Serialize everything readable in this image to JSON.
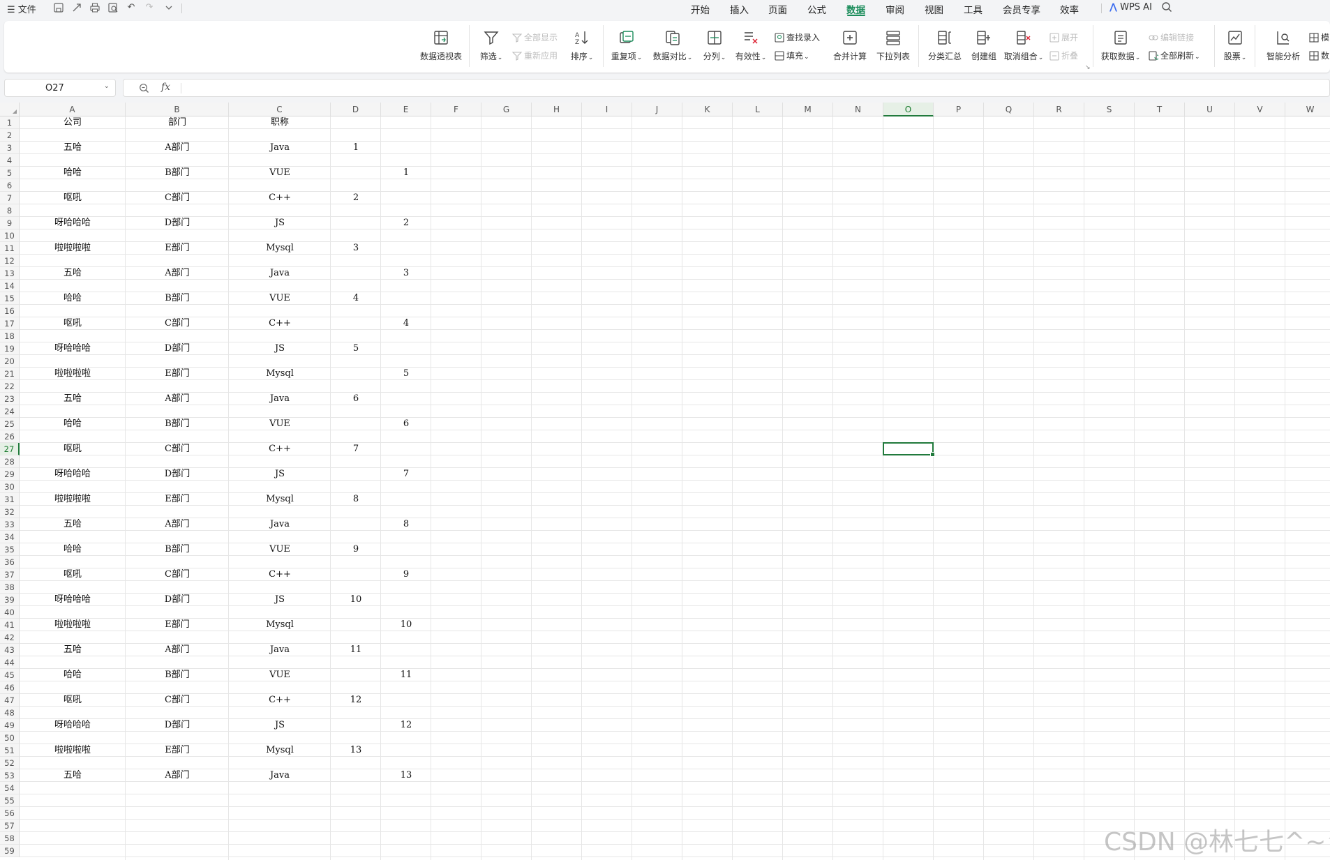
{
  "menu": {
    "file_label": "文件",
    "tabs": [
      "开始",
      "插入",
      "页面",
      "公式",
      "数据",
      "审阅",
      "视图",
      "工具",
      "会员专享",
      "效率"
    ],
    "active_tab": "数据",
    "ai_label": "WPS AI"
  },
  "ribbon": {
    "pivot": "数据透视表",
    "filter": "筛选",
    "show_all": "全部显示",
    "reapply": "重新应用",
    "sort": "排序",
    "duplicates": "重复项",
    "compare": "数据对比",
    "split": "分列",
    "validity": "有效性",
    "lookup_entry": "查找录入",
    "fill": "填充",
    "consolidate": "合并计算",
    "dropdown_list": "下拉列表",
    "subtotal": "分类汇总",
    "create_group": "创建组",
    "ungroup": "取消组合",
    "expand": "展开",
    "collapse": "折叠",
    "get_data": "获取数据",
    "edit_links": "编辑链接",
    "refresh_all": "全部刷新",
    "stocks": "股票",
    "smart_analysis": "智能分析",
    "more1": "模",
    "more2": "数"
  },
  "formula_bar": {
    "name_box": "O27",
    "fx": "fx",
    "formula": ""
  },
  "sheet": {
    "columns": [
      "A",
      "B",
      "C",
      "D",
      "E",
      "F",
      "G",
      "H",
      "I",
      "J",
      "K",
      "L",
      "M",
      "N",
      "O",
      "P",
      "Q",
      "R",
      "S",
      "T",
      "U",
      "V",
      "W"
    ],
    "selected_column": "O",
    "selected_row": 27,
    "row_count": 59,
    "headers": [
      "公司",
      "部门",
      "职称"
    ],
    "rows": [
      {
        "r": 3,
        "A": "五哈",
        "B": "A部门",
        "C": "Java",
        "D": "1",
        "E": ""
      },
      {
        "r": 5,
        "A": "哈哈",
        "B": "B部门",
        "C": "VUE",
        "D": "",
        "E": "1"
      },
      {
        "r": 7,
        "A": "呕吼",
        "B": "C部门",
        "C": "C++",
        "D": "2",
        "E": ""
      },
      {
        "r": 9,
        "A": "呀哈哈哈",
        "B": "D部门",
        "C": "JS",
        "D": "",
        "E": "2"
      },
      {
        "r": 11,
        "A": "啦啦啦啦",
        "B": "E部门",
        "C": "Mysql",
        "D": "3",
        "E": ""
      },
      {
        "r": 13,
        "A": "五哈",
        "B": "A部门",
        "C": "Java",
        "D": "",
        "E": "3"
      },
      {
        "r": 15,
        "A": "哈哈",
        "B": "B部门",
        "C": "VUE",
        "D": "4",
        "E": ""
      },
      {
        "r": 17,
        "A": "呕吼",
        "B": "C部门",
        "C": "C++",
        "D": "",
        "E": "4"
      },
      {
        "r": 19,
        "A": "呀哈哈哈",
        "B": "D部门",
        "C": "JS",
        "D": "5",
        "E": ""
      },
      {
        "r": 21,
        "A": "啦啦啦啦",
        "B": "E部门",
        "C": "Mysql",
        "D": "",
        "E": "5"
      },
      {
        "r": 23,
        "A": "五哈",
        "B": "A部门",
        "C": "Java",
        "D": "6",
        "E": ""
      },
      {
        "r": 25,
        "A": "哈哈",
        "B": "B部门",
        "C": "VUE",
        "D": "",
        "E": "6"
      },
      {
        "r": 27,
        "A": "呕吼",
        "B": "C部门",
        "C": "C++",
        "D": "7",
        "E": ""
      },
      {
        "r": 29,
        "A": "呀哈哈哈",
        "B": "D部门",
        "C": "JS",
        "D": "",
        "E": "7"
      },
      {
        "r": 31,
        "A": "啦啦啦啦",
        "B": "E部门",
        "C": "Mysql",
        "D": "8",
        "E": ""
      },
      {
        "r": 33,
        "A": "五哈",
        "B": "A部门",
        "C": "Java",
        "D": "",
        "E": "8"
      },
      {
        "r": 35,
        "A": "哈哈",
        "B": "B部门",
        "C": "VUE",
        "D": "9",
        "E": ""
      },
      {
        "r": 37,
        "A": "呕吼",
        "B": "C部门",
        "C": "C++",
        "D": "",
        "E": "9"
      },
      {
        "r": 39,
        "A": "呀哈哈哈",
        "B": "D部门",
        "C": "JS",
        "D": "10",
        "E": ""
      },
      {
        "r": 41,
        "A": "啦啦啦啦",
        "B": "E部门",
        "C": "Mysql",
        "D": "",
        "E": "10"
      },
      {
        "r": 43,
        "A": "五哈",
        "B": "A部门",
        "C": "Java",
        "D": "11",
        "E": ""
      },
      {
        "r": 45,
        "A": "哈哈",
        "B": "B部门",
        "C": "VUE",
        "D": "",
        "E": "11"
      },
      {
        "r": 47,
        "A": "呕吼",
        "B": "C部门",
        "C": "C++",
        "D": "12",
        "E": ""
      },
      {
        "r": 49,
        "A": "呀哈哈哈",
        "B": "D部门",
        "C": "JS",
        "D": "",
        "E": "12"
      },
      {
        "r": 51,
        "A": "啦啦啦啦",
        "B": "E部门",
        "C": "Mysql",
        "D": "13",
        "E": ""
      },
      {
        "r": 53,
        "A": "五哈",
        "B": "A部门",
        "C": "Java",
        "D": "",
        "E": "13"
      }
    ]
  },
  "watermark": "CSDN @林七七^~^",
  "colors": {
    "accent": "#1a8c5a",
    "selection": "#217a3c"
  }
}
